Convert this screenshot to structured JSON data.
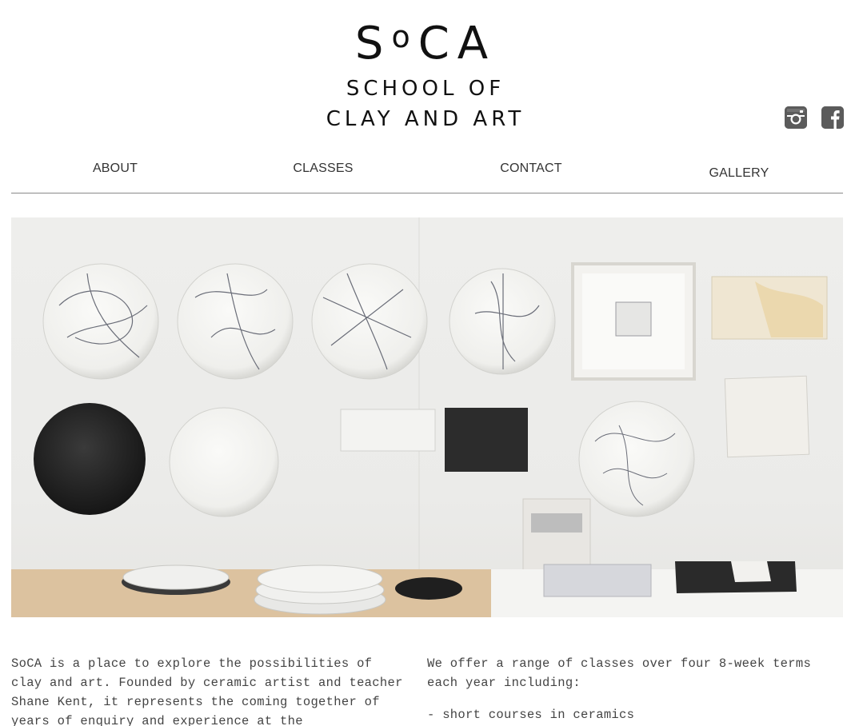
{
  "brand": {
    "mark_s": "S",
    "mark_o": "o",
    "mark_ca": "CA",
    "line1": "SCHOOL OF",
    "line2": "CLAY AND ART"
  },
  "social": {
    "instagram_icon": "instagram-icon",
    "facebook_icon": "facebook-icon"
  },
  "nav": {
    "about": "ABOUT",
    "classes": "CLASSES",
    "contact": "CONTACT",
    "gallery": "GALLERY"
  },
  "intro": {
    "left": "SoCA is a place to explore the possibilities of clay and art. Founded by ceramic artist and teacher Shane Kent, it represents the coming together of years of enquiry and experience at the",
    "right_p1": "We offer a range of classes over four 8-week terms each year including:",
    "right_p2": "- short courses in ceramics"
  },
  "colors": {
    "text": "#111111",
    "nav_text": "#333333",
    "body_text": "#444444",
    "icon_bg": "#5b5b5b",
    "divider": "#8a8a8a"
  }
}
